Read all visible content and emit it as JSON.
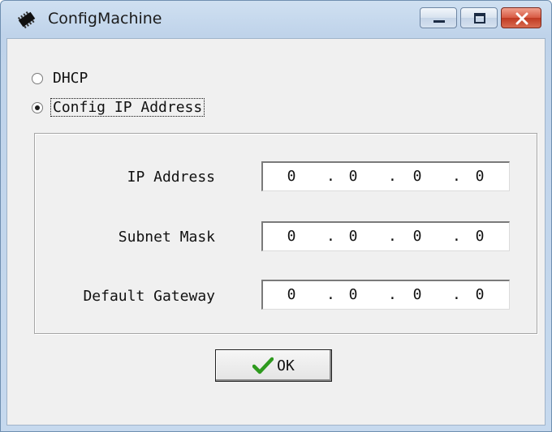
{
  "window": {
    "title": "ConfigMachine",
    "icon": "circuit-chip-icon"
  },
  "options": {
    "dhcp_label": "DHCP",
    "config_label": "Config IP Address",
    "selected": "config"
  },
  "fields": [
    {
      "label": "IP Address",
      "octets": [
        "0",
        "0",
        "0",
        "0"
      ]
    },
    {
      "label": "Subnet Mask",
      "octets": [
        "0",
        "0",
        "0",
        "0"
      ]
    },
    {
      "label": "Default Gateway",
      "octets": [
        "0",
        "0",
        "0",
        "0"
      ]
    }
  ],
  "ok_button": {
    "label": "OK",
    "icon": "checkmark-icon",
    "icon_color": "#2e9a1e"
  },
  "colors": {
    "close_button": "#c9452c",
    "titlebar": "#c6d9ee",
    "client_bg": "#f0f0f0"
  }
}
